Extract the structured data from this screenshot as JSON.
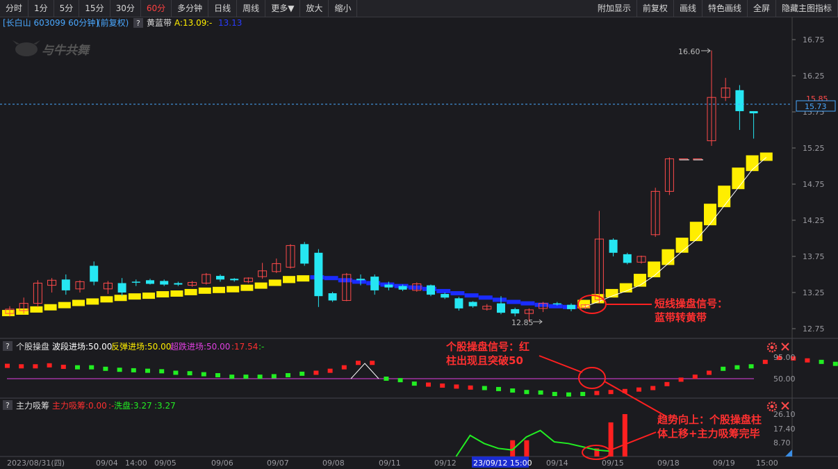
{
  "toolbar": {
    "left": [
      "分时",
      "1分",
      "5分",
      "15分",
      "30分",
      "60分",
      "多分钟",
      "日线",
      "周线",
      "更多▼",
      "放大",
      "缩小"
    ],
    "active": "60分",
    "right": [
      "附加显示",
      "前复权",
      "画线",
      "特色画线",
      "全屏",
      "隐藏主图指标"
    ]
  },
  "main": {
    "stock_label": "[长白山 603099 60分钟]",
    "fq_label": "(前复权)",
    "q_label": "?",
    "indicator_name": "黄蓝带",
    "indicator_a": "A:13.09",
    "indicator_sep": ":-",
    "indicator_b": "13.13",
    "watermark": "与牛共舞",
    "price_ticks": [
      "16.75",
      "16.25",
      "15.75",
      "15.25",
      "14.75",
      "14.25",
      "13.75",
      "13.25",
      "12.75"
    ],
    "price_tick_values": [
      16.75,
      16.25,
      15.75,
      15.25,
      14.75,
      14.25,
      13.75,
      13.25,
      12.75
    ],
    "current_price": "15.73",
    "current_price_upper": "15.85",
    "high_marker": "16.60",
    "low_marker": "12.85",
    "annotation": [
      "短线操盘信号：",
      "蓝带转黄带"
    ]
  },
  "panel1": {
    "q_label": "?",
    "name": "个股操盘",
    "l1": "波段进场:50.00",
    "l2": "反弹进场:50.00",
    "l3": "超跌进场:50.00",
    "l4": ":17.54",
    "l5": ":-",
    "ticks": [
      "95.00",
      "50.00"
    ],
    "annotation": [
      "个股操盘信号：红",
      "柱出现且突破50"
    ]
  },
  "panel2": {
    "q_label": "?",
    "name": "主力吸筹",
    "l1": "主力吸筹:0.00",
    "l2": ":-",
    "l3": "洗盘:3.27",
    "l4": ":3.27",
    "ticks": [
      "26.10",
      "17.40",
      "8.70"
    ],
    "annotation": [
      "趋势向上：个股操盘柱",
      "体上移+主力吸筹完毕"
    ]
  },
  "xaxis": {
    "labels": [
      "2023/08/31(四)",
      "09/04",
      "14:00",
      "09/05",
      "09/06",
      "09/07",
      "09/08",
      "09/11",
      "09/12",
      "23/09/12 15:00",
      "09/14",
      "09/15",
      "09/18",
      "09/19",
      "15:00"
    ],
    "highlight": "23/09/12 15:00"
  },
  "colors": {
    "up": "#ff4a4a",
    "down": "#26e6f2",
    "yellow": "#ffee00",
    "blue": "#1a2cff",
    "magenta": "#e040e0",
    "green": "#22ee22",
    "red": "#ff2020",
    "bg": "#1b1b1f",
    "axis": "#9a9aa0"
  },
  "chart_data": {
    "type": "candlestick",
    "description_note": "",
    "price_candles": [
      {
        "o": 12.96,
        "c": 13.02,
        "h": 13.06,
        "l": 12.92
      },
      {
        "o": 13.0,
        "c": 13.1,
        "h": 13.18,
        "l": 12.96
      },
      {
        "o": 13.1,
        "c": 13.38,
        "h": 13.42,
        "l": 13.05
      },
      {
        "o": 13.35,
        "c": 13.42,
        "h": 13.45,
        "l": 13.25
      },
      {
        "o": 13.43,
        "c": 13.28,
        "h": 13.5,
        "l": 13.22
      },
      {
        "o": 13.3,
        "c": 13.4,
        "h": 13.42,
        "l": 13.25
      },
      {
        "o": 13.62,
        "c": 13.4,
        "h": 13.68,
        "l": 13.35
      },
      {
        "o": 13.3,
        "c": 13.38,
        "h": 13.41,
        "l": 13.23
      },
      {
        "o": 13.38,
        "c": 13.25,
        "h": 13.45,
        "l": 13.2
      },
      {
        "o": 13.4,
        "c": 13.39,
        "h": 13.43,
        "l": 13.34
      },
      {
        "o": 13.42,
        "c": 13.37,
        "h": 13.44,
        "l": 13.36
      },
      {
        "o": 13.41,
        "c": 13.36,
        "h": 13.43,
        "l": 13.34
      },
      {
        "o": 13.38,
        "c": 13.36,
        "h": 13.4,
        "l": 13.34
      },
      {
        "o": 13.35,
        "c": 13.39,
        "h": 13.41,
        "l": 13.33
      },
      {
        "o": 13.38,
        "c": 13.5,
        "h": 13.52,
        "l": 13.36
      },
      {
        "o": 13.48,
        "c": 13.43,
        "h": 13.5,
        "l": 13.4
      },
      {
        "o": 13.44,
        "c": 13.42,
        "h": 13.45,
        "l": 13.4
      },
      {
        "o": 13.4,
        "c": 13.45,
        "h": 13.46,
        "l": 13.38
      },
      {
        "o": 13.47,
        "c": 13.55,
        "h": 13.66,
        "l": 13.44
      },
      {
        "o": 13.54,
        "c": 13.65,
        "h": 13.72,
        "l": 13.52
      },
      {
        "o": 13.6,
        "c": 13.9,
        "h": 13.92,
        "l": 13.58
      },
      {
        "o": 13.92,
        "c": 13.65,
        "h": 13.95,
        "l": 13.62
      },
      {
        "o": 13.8,
        "c": 13.2,
        "h": 13.85,
        "l": 13.05
      },
      {
        "o": 13.24,
        "c": 13.14,
        "h": 13.26,
        "l": 13.12
      },
      {
        "o": 13.14,
        "c": 13.5,
        "h": 13.52,
        "l": 13.13
      },
      {
        "o": 13.44,
        "c": 13.42,
        "h": 13.5,
        "l": 13.35
      },
      {
        "o": 13.47,
        "c": 13.28,
        "h": 13.5,
        "l": 13.22
      },
      {
        "o": 13.36,
        "c": 13.32,
        "h": 13.4,
        "l": 13.28
      },
      {
        "o": 13.34,
        "c": 13.29,
        "h": 13.36,
        "l": 13.27
      },
      {
        "o": 13.28,
        "c": 13.37,
        "h": 13.39,
        "l": 13.26
      },
      {
        "o": 13.35,
        "c": 13.22,
        "h": 13.36,
        "l": 13.2
      },
      {
        "o": 13.23,
        "c": 13.18,
        "h": 13.25,
        "l": 13.16
      },
      {
        "o": 13.17,
        "c": 13.03,
        "h": 13.19,
        "l": 13.0
      },
      {
        "o": 13.12,
        "c": 13.06,
        "h": 13.13,
        "l": 13.04
      },
      {
        "o": 13.02,
        "c": 13.06,
        "h": 13.09,
        "l": 13.0
      },
      {
        "o": 13.1,
        "c": 12.97,
        "h": 13.2,
        "l": 12.95
      },
      {
        "o": 13.02,
        "c": 12.96,
        "h": 13.04,
        "l": 12.92
      },
      {
        "o": 12.96,
        "c": 13.01,
        "h": 13.03,
        "l": 12.85
      },
      {
        "o": 13.03,
        "c": 13.1,
        "h": 13.12,
        "l": 12.98
      },
      {
        "o": 13.1,
        "c": 13.09,
        "h": 13.12,
        "l": 13.07
      },
      {
        "o": 13.08,
        "c": 13.02,
        "h": 13.1,
        "l": 12.99
      },
      {
        "o": 13.04,
        "c": 13.08,
        "h": 13.09,
        "l": 13.02
      },
      {
        "o": 13.15,
        "c": 13.99,
        "h": 14.38,
        "l": 13.1
      },
      {
        "o": 13.98,
        "c": 13.8,
        "h": 14.0,
        "l": 13.75
      },
      {
        "o": 13.78,
        "c": 13.66,
        "h": 13.8,
        "l": 13.64
      },
      {
        "o": 13.67,
        "c": 13.75,
        "h": 13.76,
        "l": 13.65
      },
      {
        "o": 14.05,
        "c": 14.65,
        "h": 14.7,
        "l": 14.02
      },
      {
        "o": 14.65,
        "c": 15.1,
        "h": 15.12,
        "l": 14.6
      },
      {
        "o": 15.1,
        "c": 15.1,
        "h": 15.1,
        "l": 15.1
      },
      {
        "o": 15.1,
        "c": 15.1,
        "h": 15.1,
        "l": 15.1
      },
      {
        "o": 15.35,
        "c": 15.95,
        "h": 16.6,
        "l": 15.28
      },
      {
        "o": 15.95,
        "c": 16.08,
        "h": 16.22,
        "l": 15.9
      },
      {
        "o": 16.05,
        "c": 15.76,
        "h": 16.12,
        "l": 15.5
      },
      {
        "o": 15.76,
        "c": 15.73,
        "h": 15.76,
        "l": 15.38
      }
    ],
    "band": [
      12.96,
      12.98,
      13.0,
      13.03,
      13.06,
      13.09,
      13.12,
      13.14,
      13.17,
      13.19,
      13.21,
      13.22,
      13.24,
      13.25,
      13.27,
      13.29,
      13.3,
      13.31,
      13.33,
      13.36,
      13.4,
      13.45,
      13.46,
      13.45,
      13.42,
      13.4,
      13.38,
      13.36,
      13.34,
      13.32,
      13.3,
      13.27,
      13.24,
      13.21,
      13.18,
      13.15,
      13.12,
      13.1,
      13.08,
      13.06,
      13.05,
      13.05,
      13.12,
      13.2,
      13.27,
      13.35,
      13.48,
      13.65,
      13.82,
      13.98,
      14.2,
      14.45,
      14.7,
      14.95,
      15.12
    ],
    "band_type": [
      "Y",
      "Y",
      "Y",
      "Y",
      "Y",
      "Y",
      "Y",
      "Y",
      "Y",
      "Y",
      "Y",
      "Y",
      "Y",
      "Y",
      "Y",
      "Y",
      "Y",
      "Y",
      "Y",
      "Y",
      "Y",
      "Y",
      "B",
      "B",
      "B",
      "B",
      "B",
      "B",
      "B",
      "B",
      "B",
      "B",
      "B",
      "B",
      "B",
      "B",
      "B",
      "B",
      "B",
      "B",
      "B",
      "Y",
      "Y",
      "Y",
      "Y",
      "Y",
      "Y",
      "Y",
      "Y",
      "Y",
      "Y",
      "Y",
      "Y",
      "Y",
      "Y"
    ],
    "panel1_values": [
      76,
      75,
      75,
      77,
      74,
      73,
      73,
      70,
      68,
      67,
      66,
      65,
      62,
      61,
      59,
      57,
      54,
      54,
      54,
      55,
      57,
      60,
      62,
      66,
      73,
      82,
      82,
      50,
      47,
      40,
      38,
      36,
      34,
      32,
      31,
      29,
      26,
      23,
      22,
      19,
      18,
      19,
      21,
      23,
      25,
      28,
      31,
      39,
      48,
      54,
      62,
      70,
      73,
      75,
      84,
      92,
      91,
      87,
      84,
      80
    ],
    "panel1_colors": [
      "R",
      "R",
      "R",
      "R",
      "R",
      "G",
      "G",
      "G",
      "G",
      "G",
      "G",
      "G",
      "G",
      "G",
      "G",
      "G",
      "G",
      "G",
      "G",
      "G",
      "G",
      "G",
      "R",
      "R",
      "R",
      "R",
      "R",
      "G",
      "G",
      "G",
      "R",
      "R",
      "R",
      "R",
      "G",
      "G",
      "G",
      "G",
      "G",
      "G",
      "G",
      "G",
      "R",
      "R",
      "R",
      "R",
      "R",
      "R",
      "R",
      "R",
      "R",
      "G",
      "G",
      "G",
      "R",
      "R",
      "R",
      "R",
      "G",
      "G"
    ],
    "panel2_bars": [
      {
        "i": 36,
        "v": 10,
        "c": "R"
      },
      {
        "i": 37,
        "v": 10,
        "c": "R"
      },
      {
        "i": 42,
        "v": 5,
        "c": "R"
      },
      {
        "i": 43,
        "v": 21,
        "c": "R"
      },
      {
        "i": 44,
        "v": 26.1,
        "c": "R"
      }
    ],
    "panel2_line": [
      [
        32,
        0
      ],
      [
        33,
        13
      ],
      [
        34,
        8
      ],
      [
        35,
        5
      ],
      [
        36,
        4
      ],
      [
        37,
        12
      ],
      [
        38,
        16
      ],
      [
        39,
        9
      ],
      [
        40,
        8
      ],
      [
        41,
        6
      ],
      [
        42,
        4
      ],
      [
        43,
        3.27
      ]
    ]
  }
}
